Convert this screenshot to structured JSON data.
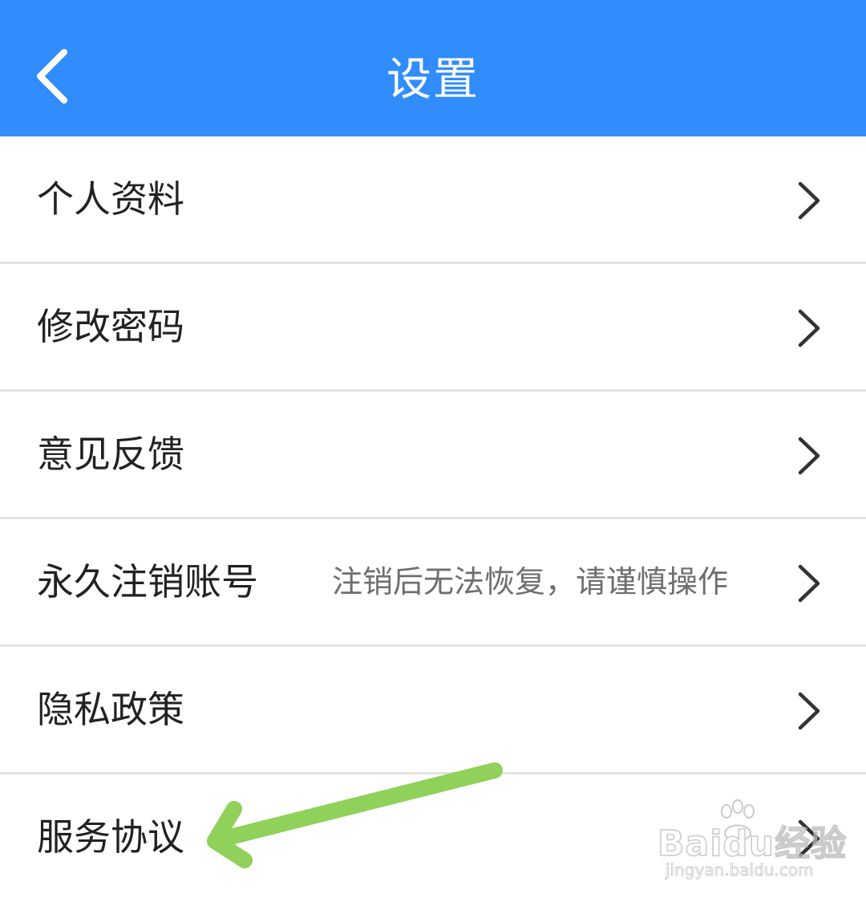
{
  "header": {
    "title": "设置",
    "background_color": "#318cfd",
    "back_icon": "chevron-left-icon"
  },
  "settings": {
    "items": [
      {
        "label": "个人资料",
        "hint": ""
      },
      {
        "label": "修改密码",
        "hint": ""
      },
      {
        "label": "意见反馈",
        "hint": ""
      },
      {
        "label": "永久注销账号",
        "hint": "注销后无法恢复，请谨慎操作"
      },
      {
        "label": "隐私政策",
        "hint": ""
      },
      {
        "label": "服务协议",
        "hint": ""
      }
    ],
    "row_icon": "chevron-right-icon",
    "divider_color": "#e3e3e3"
  },
  "annotation": {
    "arrow_color": "#8fd15a",
    "points_to": "服务协议"
  },
  "watermark": {
    "brand": "Baidu经验",
    "url": "jingyan.baidu.com"
  }
}
